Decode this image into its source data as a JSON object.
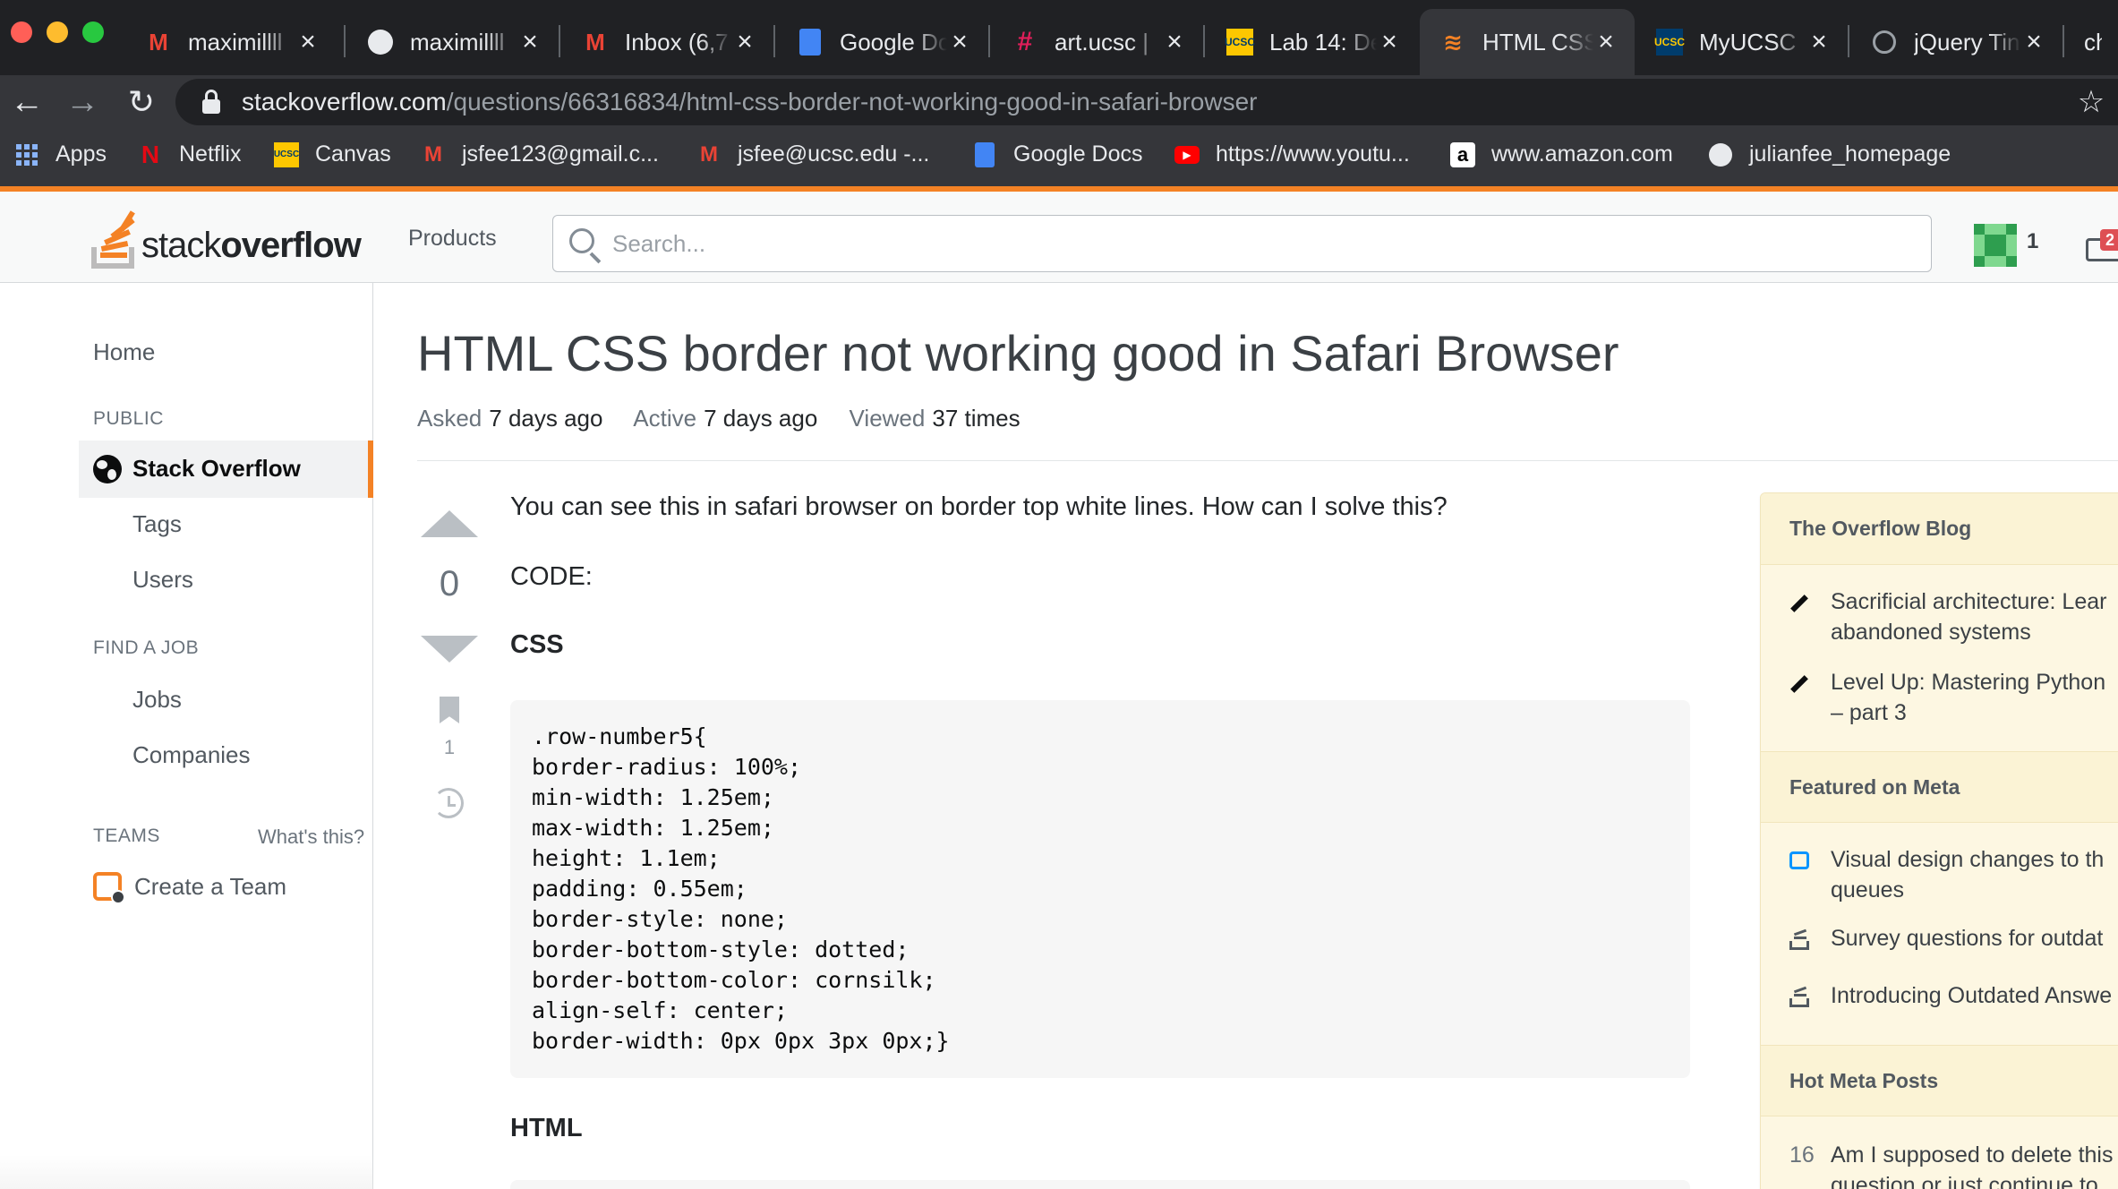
{
  "browser": {
    "tabs": [
      {
        "title": "maximillll",
        "icon": "gmail-icon",
        "active": false
      },
      {
        "title": "maximillll",
        "icon": "github-icon",
        "active": false
      },
      {
        "title": "Inbox (6,7",
        "icon": "gmail-icon",
        "active": false
      },
      {
        "title": "Google Do",
        "icon": "google-docs-icon",
        "active": false
      },
      {
        "title": "art.ucsc |",
        "icon": "slack-icon",
        "active": false
      },
      {
        "title": "Lab 14: De",
        "icon": "ucsc-icon",
        "active": false
      },
      {
        "title": "HTML CSS",
        "icon": "stackoverflow-icon",
        "active": true
      },
      {
        "title": "MyUCSC",
        "icon": "ucsc-icon",
        "active": false
      },
      {
        "title": "jQuery Tin",
        "icon": "globe-icon",
        "active": false
      },
      {
        "title": "chr",
        "icon": "",
        "active": false
      }
    ],
    "tab_close": "×",
    "url_host": "stackoverflow.com",
    "url_path": "/questions/66316834/html-css-border-not-working-good-in-safari-browser",
    "bookmarks": [
      {
        "label": "Apps",
        "icon": "apps-grid-icon"
      },
      {
        "label": "Netflix",
        "icon": "netflix-icon"
      },
      {
        "label": "Canvas",
        "icon": "ucsc-icon"
      },
      {
        "label": "jsfee123@gmail.c...",
        "icon": "gmail-icon"
      },
      {
        "label": "jsfee@ucsc.edu -...",
        "icon": "gmail-icon"
      },
      {
        "label": "Google Docs",
        "icon": "google-docs-icon"
      },
      {
        "label": "https://www.youtu...",
        "icon": "youtube-icon"
      },
      {
        "label": "www.amazon.com",
        "icon": "amazon-icon"
      },
      {
        "label": "julianfee_homepage",
        "icon": "globe-icon"
      }
    ]
  },
  "header": {
    "logo_light": "stack",
    "logo_bold": "overflow",
    "products": "Products",
    "search_placeholder": "Search...",
    "reputation": "1",
    "inbox_badge": "2",
    "accent": "#f48225"
  },
  "leftnav": {
    "home": "Home",
    "public_heading": "PUBLIC",
    "stack_overflow": "Stack Overflow",
    "tags": "Tags",
    "users": "Users",
    "find_job_heading": "FIND A JOB",
    "jobs": "Jobs",
    "companies": "Companies",
    "teams_heading": "TEAMS",
    "whats_this": "What's this?",
    "create_team": "Create a Team"
  },
  "question": {
    "title": "HTML CSS border not working good in Safari Browser",
    "asked_label": "Asked",
    "asked_value": "7 days ago",
    "active_label": "Active",
    "active_value": "7 days ago",
    "viewed_label": "Viewed",
    "viewed_value": "37 times",
    "votes": "0",
    "bookmarks": "1",
    "body_p1": "You can see this in safari browser on border top white lines. How can I solve this?",
    "body_p2": "CODE:",
    "css_heading": "CSS",
    "css_code": ".row-number5{\nborder-radius: 100%;\nmin-width: 1.25em;\nmax-width: 1.25em;\nheight: 1.1em;\npadding: 0.55em;\nborder-style: none;\nborder-bottom-style: dotted;\nborder-bottom-color: cornsilk;\nalign-self: center;\nborder-width: 0px 0px 3px 0px;}",
    "html_heading": "HTML"
  },
  "sidebar": {
    "blog_heading": "The Overflow Blog",
    "blog_items": [
      {
        "line1": "Sacrificial architecture: Lear",
        "line2": "abandoned systems"
      },
      {
        "line1": "Level Up: Mastering Python",
        "line2": "– part 3"
      }
    ],
    "meta_heading": "Featured on Meta",
    "meta_items": [
      {
        "line1": "Visual design changes to th",
        "line2": "queues"
      },
      {
        "line1": "Survey questions for outdat",
        "line2": ""
      },
      {
        "line1": "Introducing Outdated Answe",
        "line2": ""
      }
    ],
    "hot_heading": "Hot Meta Posts",
    "hot_items": [
      {
        "count": "16",
        "line1": "Am I supposed to delete this",
        "line2": "question or just continue to"
      }
    ]
  }
}
